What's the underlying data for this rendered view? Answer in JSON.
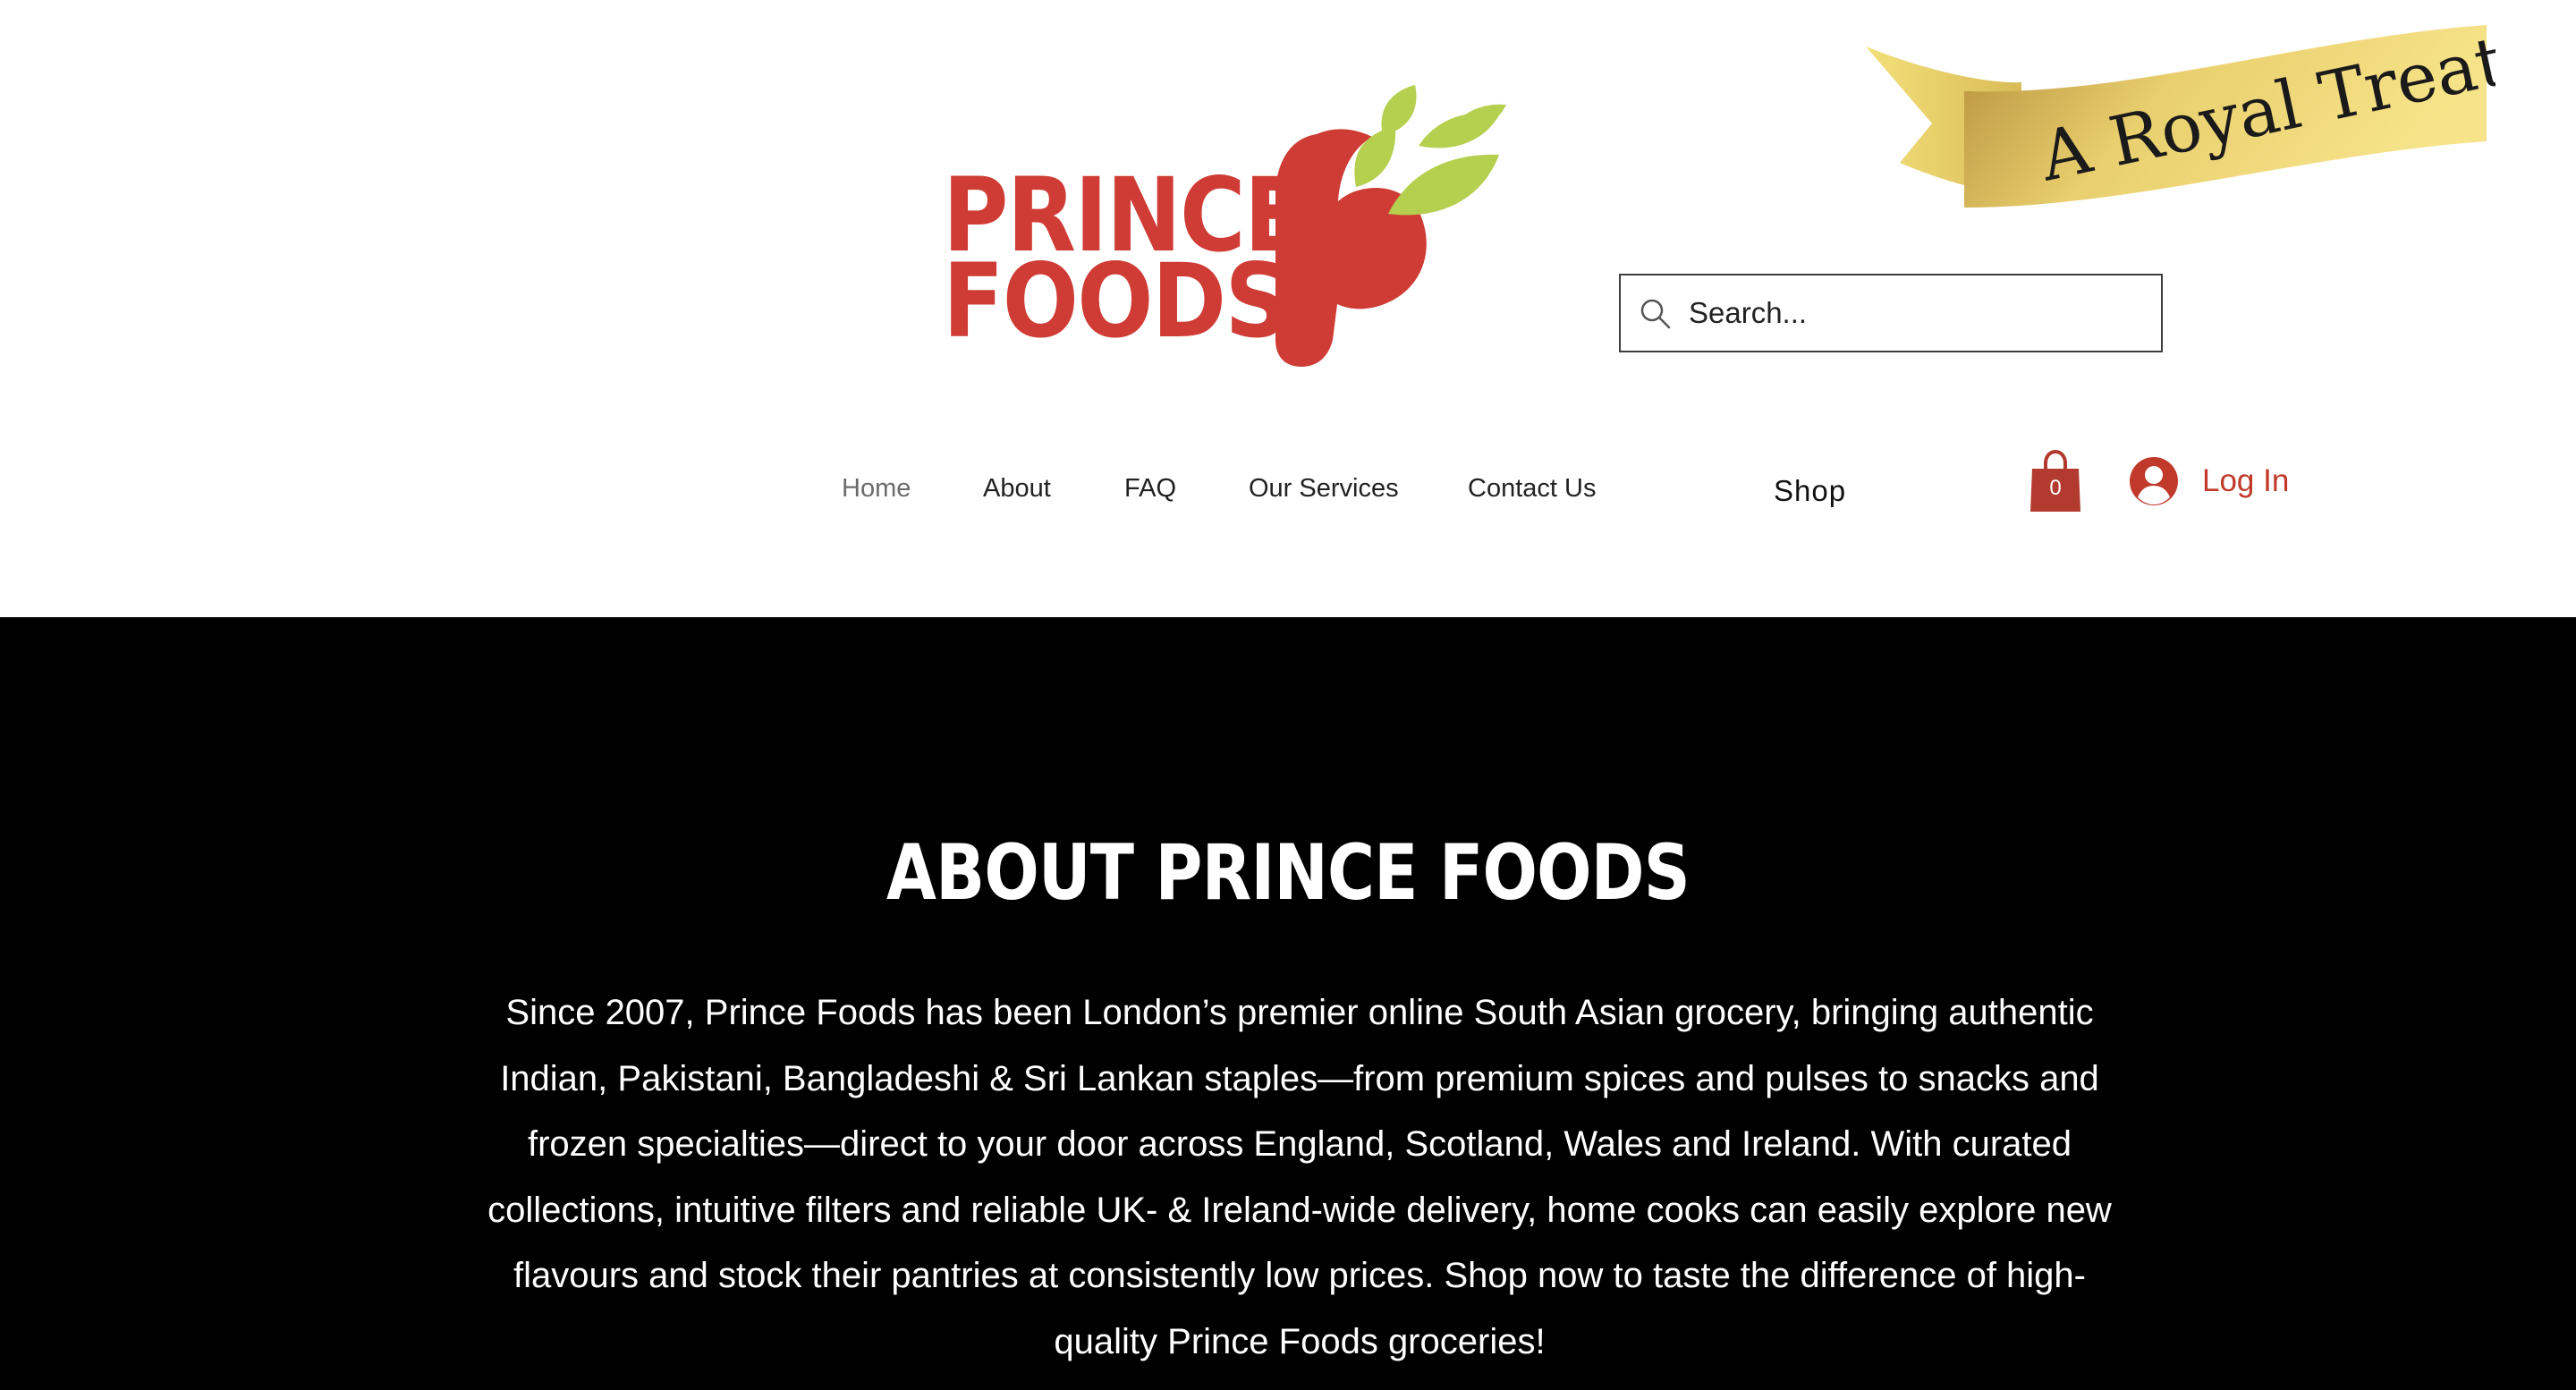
{
  "header": {
    "logo": {
      "line1": "PRINCE",
      "line2": "FOODS",
      "red": "#cf3c35",
      "leaf_green": "#b5cf4e"
    },
    "ribbon": {
      "text": "A Royal Treat",
      "gold_light": "#f5e27a",
      "gold_dark": "#b8953c"
    },
    "search": {
      "placeholder": "Search...",
      "value": ""
    },
    "nav": [
      {
        "label": "Home",
        "active": true
      },
      {
        "label": "About",
        "active": false
      },
      {
        "label": "FAQ",
        "active": false
      },
      {
        "label": "Our Services",
        "active": false
      },
      {
        "label": "Contact Us",
        "active": false
      }
    ],
    "shop_label": "Shop",
    "cart": {
      "count": "0",
      "color": "#b23a2e"
    },
    "login": {
      "label": "Log In",
      "color": "#c0392b"
    }
  },
  "about": {
    "title": "ABOUT PRINCE FOODS",
    "body": "Since 2007, Prince Foods has been London’s premier online South Asian grocery, bringing authentic Indian, Pakistani, Bangladeshi & Sri Lankan staples—from premium spices and pulses to snacks and frozen specialties—direct to your door across England, Scotland, Wales and Ireland. With curated collections, intuitive filters and reliable UK- & Ireland-wide delivery, home cooks can easily explore new flavours and stock their pantries at consistently low prices. Shop now to taste the difference of high-quality Prince Foods groceries!",
    "background": "#000000"
  }
}
